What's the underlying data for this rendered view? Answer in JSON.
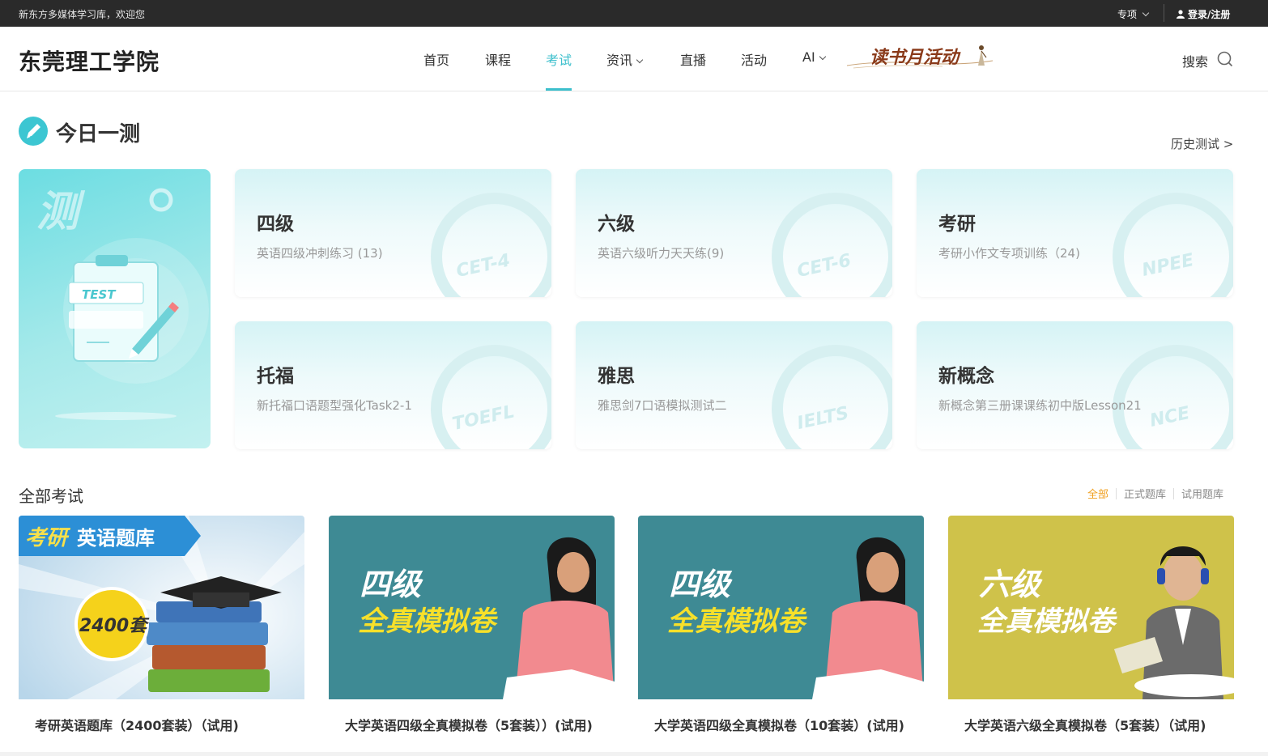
{
  "topbar": {
    "welcome": "新东方多媒体学习库，欢迎您",
    "special": "专项",
    "login": "登录/注册"
  },
  "header": {
    "brand": "东莞理工学院",
    "nav": [
      {
        "label": "首页",
        "active": false
      },
      {
        "label": "课程",
        "active": false
      },
      {
        "label": "考试",
        "active": true
      },
      {
        "label": "资讯",
        "active": false,
        "dropdown": true
      },
      {
        "label": "直播",
        "active": false
      },
      {
        "label": "活动",
        "active": false
      },
      {
        "label": "AI",
        "active": false,
        "dropdown": true
      }
    ],
    "event_logo_text": "读书月活动",
    "search_label": "搜索"
  },
  "today": {
    "title": "今日一测",
    "history_link": "历史测试 >",
    "hero_char": "测",
    "hero_badge": "TEST",
    "cards": [
      {
        "title": "四级",
        "subtitle": "英语四级冲刺练习 (13)",
        "watermark": "CET-4"
      },
      {
        "title": "六级",
        "subtitle": "英语六级听力天天练(9)",
        "watermark": "CET-6"
      },
      {
        "title": "考研",
        "subtitle": "考研小作文专项训练（24)",
        "watermark": "NPEE"
      },
      {
        "title": "托福",
        "subtitle": "新托福口语题型强化Task2-1",
        "watermark": "TOEFL"
      },
      {
        "title": "雅思",
        "subtitle": "雅思剑7口语模拟测试二",
        "watermark": "IELTS"
      },
      {
        "title": "新概念",
        "subtitle": "新概念第三册课课练初中版Lesson21",
        "watermark": "NCE"
      }
    ]
  },
  "all_exams": {
    "title": "全部考试",
    "filters": [
      "全部",
      "正式题库",
      "试用题库"
    ],
    "active_filter": "全部",
    "courses": [
      {
        "title": "考研英语题库（2400套装）（试用)",
        "banner_line1": "考研",
        "banner_line2": "英语题库",
        "badge": "2400套"
      },
      {
        "title": "大学英语四级全真模拟卷（5套装））(试用)",
        "banner_line1": "四级",
        "banner_line2": "全真模拟卷"
      },
      {
        "title": "大学英语四级全真模拟卷（10套装）(试用)",
        "banner_line1": "四级",
        "banner_line2": "全真模拟卷"
      },
      {
        "title": "大学英语六级全真模拟卷（5套装）（试用)",
        "banner_line1": "六级",
        "banner_line2": "全真模拟卷"
      }
    ]
  },
  "colors": {
    "accent": "#3bbfcc",
    "filter_active": "#f0a020",
    "topbar_bg": "#2a2a2a",
    "teal_banner": "#3e8a94",
    "olive_banner": "#cfc24a"
  }
}
